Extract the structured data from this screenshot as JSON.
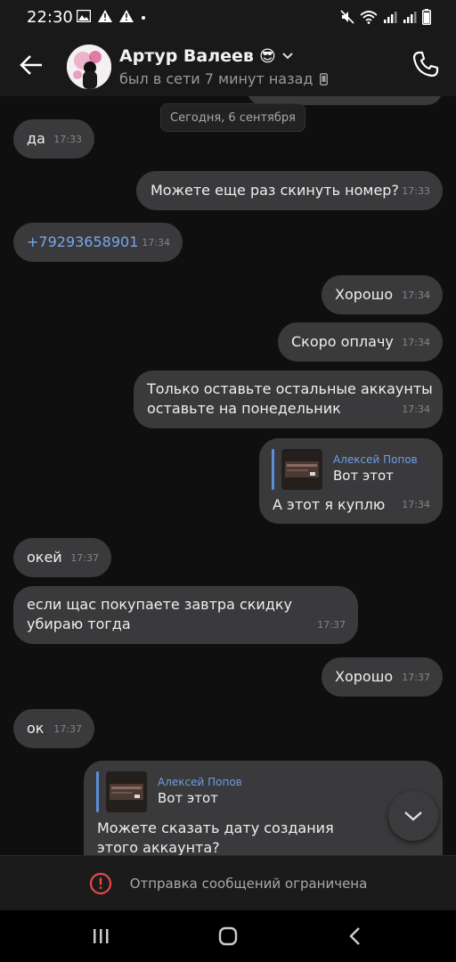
{
  "status_bar": {
    "time": "22:30",
    "left_icons": [
      "image-icon",
      "warning-icon",
      "warning-icon",
      "dot-icon"
    ],
    "right_icons": [
      "mute-icon",
      "wifi-icon",
      "signal-icon",
      "signal-icon",
      "battery-icon"
    ]
  },
  "header": {
    "contact_name": "Артур Валеев",
    "emoji": "😎",
    "last_seen": "был в сети 7 минут назад"
  },
  "chat": {
    "date_chip": "Сегодня, 6 сентября",
    "messages": [
      {
        "side": "in",
        "text": "да",
        "time": "17:33"
      },
      {
        "side": "out",
        "text": "Можете еще раз скинуть номер?",
        "time": "17:33"
      },
      {
        "side": "in",
        "text": "+79293658901",
        "time": "17:34",
        "kind": "phone"
      },
      {
        "side": "out",
        "text": "Хорошо",
        "time": "17:34"
      },
      {
        "side": "out",
        "text": "Скоро оплачу",
        "time": "17:34"
      },
      {
        "side": "out",
        "text": "Только оставьте остальные аккаунты оставьте на понедельник",
        "time": "17:34"
      },
      {
        "side": "out",
        "text": "А этот я куплю",
        "time": "17:34",
        "reply": {
          "author": "Алексей Попов",
          "text": "Вот этот"
        }
      },
      {
        "side": "in",
        "text": "окей",
        "time": "17:37"
      },
      {
        "side": "in",
        "text": "если щас покупаете завтра скидку убираю тогда",
        "time": "17:37"
      },
      {
        "side": "out",
        "text": "Хорошо",
        "time": "17:37"
      },
      {
        "side": "in",
        "text": "ок",
        "time": "17:37"
      },
      {
        "side": "out",
        "text": "Можете сказать дату создания этого аккаунта?",
        "time": "",
        "reply": {
          "author": "Алексей Попов",
          "text": "Вот этот"
        }
      }
    ]
  },
  "restriction": {
    "text": "Отправка сообщений ограничена",
    "icon": "alert-circle-icon",
    "icon_color": "#e5484d"
  },
  "colors": {
    "link": "#75a7ee",
    "reply_accent": "#5b8fd6",
    "bubble": "#3a3a3c"
  }
}
